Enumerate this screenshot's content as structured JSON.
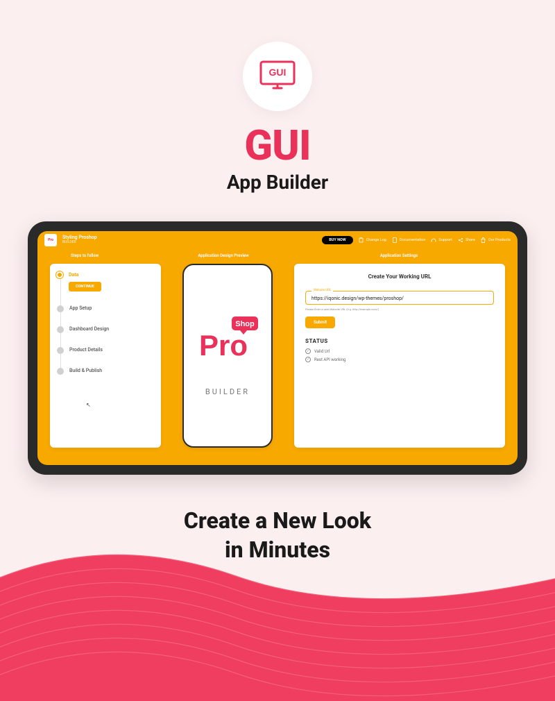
{
  "hero": {
    "icon_text": "GUI",
    "title": "GUI",
    "subtitle": "App Builder"
  },
  "app": {
    "brand_small": "Pro",
    "brand_title": "Styling Proshop",
    "brand_sub": "BUILDER",
    "buy_now": "BUY NOW",
    "nav": {
      "changelog": "Change Log",
      "documentation": "Documentation",
      "support": "Support",
      "share": "Share",
      "products": "Our Products"
    },
    "headers": {
      "steps": "Steps to follow",
      "preview": "Application Design Preview",
      "settings": "Application Settings"
    },
    "steps": [
      {
        "label": "Data",
        "active": true,
        "button": "CONTINUE"
      },
      {
        "label": "App Setup",
        "active": false
      },
      {
        "label": "Dashboard Design",
        "active": false
      },
      {
        "label": "Product Details",
        "active": false
      },
      {
        "label": "Build & Publish",
        "active": false
      }
    ],
    "phone": {
      "logo_shop": "Shop",
      "logo_main": "Pro",
      "builder": "BUILDER"
    },
    "settings": {
      "title": "Create Your Working URL",
      "url_label": "Website URL",
      "url_value": "https://iqonic.design/wp-themes/proshop/",
      "url_hint": "Please Enter a valid Website URL (e.g. http://example.com/)",
      "submit": "Submit",
      "status_title": "STATUS",
      "status_items": [
        "Valid Url",
        "Rest API working"
      ]
    }
  },
  "footer": {
    "line1": "Create a New Look",
    "line2": "in Minutes"
  },
  "colors": {
    "accent_red": "#e9315a",
    "accent_orange": "#f7a900"
  }
}
